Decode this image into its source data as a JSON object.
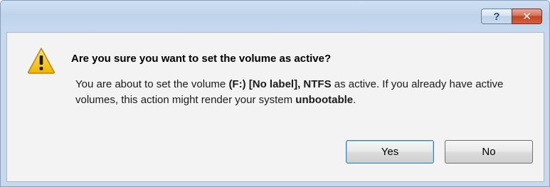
{
  "titlebar": {
    "help_label": "?",
    "close_label": "✕"
  },
  "dialog": {
    "icon": "warning-icon",
    "heading": "Are you sure you want to set the volume as active?",
    "message": {
      "part1": "You are about to set the volume ",
      "volume": "(F:) [No label], NTFS",
      "part2": " as active. If you already have active volumes, this action might render your system ",
      "emphasis": "unbootable",
      "part3": "."
    }
  },
  "buttons": {
    "yes_label": "Yes",
    "no_label": "No"
  },
  "colors": {
    "title_gradient_top": "#cfe0f2",
    "close_button": "#c34326",
    "content_background": "#f3f3f3",
    "warning_yellow": "#f5c400"
  }
}
